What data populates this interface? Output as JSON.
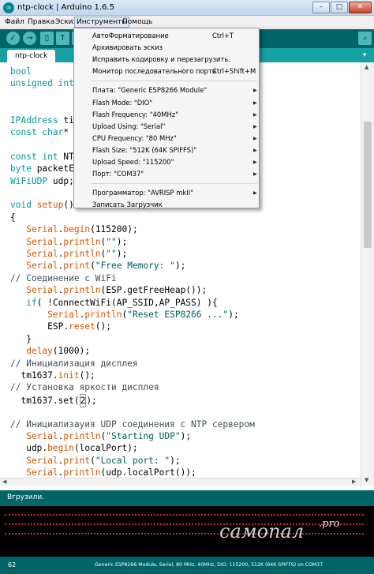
{
  "window": {
    "title": "ntp-clock | Arduino 1.6.5",
    "app_icon": "arduino-infinity-icon",
    "min_symbol": "–",
    "max_symbol": "□",
    "close_symbol": "✕"
  },
  "menubar": {
    "file": "Файл",
    "edit": "Правка",
    "sketch": "Эскиз",
    "tools": "Инструменты",
    "help": "Помощь"
  },
  "toolbar": {
    "verify_icon": "✓",
    "upload_icon": "→",
    "new_icon": "▯",
    "open_icon": "↑",
    "save_icon": "↓",
    "serial_icon": "⌕"
  },
  "tabs": {
    "active": "ntp-clock",
    "menu_icon": "▾"
  },
  "code": [
    [
      {
        "t": "kw",
        "v": "bool"
      }
    ],
    [
      {
        "t": "kw",
        "v": "unsigned int"
      }
    ],
    [],
    [],
    [
      {
        "t": "kw",
        "v": "IPAddress"
      },
      {
        "t": "tx",
        "v": " ti"
      }
    ],
    [
      {
        "t": "kw",
        "v": "const char"
      },
      {
        "t": "tx",
        "v": "*"
      }
    ],
    [],
    [
      {
        "t": "kw",
        "v": "const int"
      },
      {
        "t": "tx",
        "v": " NT"
      }
    ],
    [
      {
        "t": "kw",
        "v": "byte"
      },
      {
        "t": "tx",
        "v": " packetE"
      }
    ],
    [
      {
        "t": "kw",
        "v": "WiFiUDP"
      },
      {
        "t": "tx",
        "v": " udp;"
      }
    ],
    [],
    [
      {
        "t": "kw",
        "v": "void"
      },
      {
        "t": "tx",
        "v": " "
      },
      {
        "t": "fn",
        "v": "setup"
      },
      {
        "t": "tx",
        "v": "()"
      }
    ],
    [
      {
        "t": "tx",
        "v": "{"
      }
    ],
    [
      {
        "t": "tx",
        "v": "   "
      },
      {
        "t": "fn",
        "v": "Serial"
      },
      {
        "t": "tx",
        "v": "."
      },
      {
        "t": "fn",
        "v": "begin"
      },
      {
        "t": "tx",
        "v": "(115200);"
      }
    ],
    [
      {
        "t": "tx",
        "v": "   "
      },
      {
        "t": "fn",
        "v": "Serial"
      },
      {
        "t": "tx",
        "v": "."
      },
      {
        "t": "fn",
        "v": "println"
      },
      {
        "t": "tx",
        "v": "("
      },
      {
        "t": "str",
        "v": "\"\""
      },
      {
        "t": "tx",
        "v": ");"
      }
    ],
    [
      {
        "t": "tx",
        "v": "   "
      },
      {
        "t": "fn",
        "v": "Serial"
      },
      {
        "t": "tx",
        "v": "."
      },
      {
        "t": "fn",
        "v": "println"
      },
      {
        "t": "tx",
        "v": "("
      },
      {
        "t": "str",
        "v": "\"\""
      },
      {
        "t": "tx",
        "v": ");"
      }
    ],
    [
      {
        "t": "tx",
        "v": "   "
      },
      {
        "t": "fn",
        "v": "Serial"
      },
      {
        "t": "tx",
        "v": "."
      },
      {
        "t": "fn",
        "v": "print"
      },
      {
        "t": "tx",
        "v": "("
      },
      {
        "t": "str",
        "v": "\"Free Memory: \""
      },
      {
        "t": "tx",
        "v": ");"
      }
    ],
    [
      {
        "t": "cm",
        "v": "// Соединение с WiFi"
      }
    ],
    [
      {
        "t": "tx",
        "v": "   "
      },
      {
        "t": "fn",
        "v": "Serial"
      },
      {
        "t": "tx",
        "v": "."
      },
      {
        "t": "fn",
        "v": "println"
      },
      {
        "t": "tx",
        "v": "(ESP.getFreeHeap());"
      }
    ],
    [
      {
        "t": "tx",
        "v": "   "
      },
      {
        "t": "kw",
        "v": "if"
      },
      {
        "t": "tx",
        "v": "( !ConnectWiFi(AP_SSID,AP_PASS) ){"
      }
    ],
    [
      {
        "t": "tx",
        "v": "       "
      },
      {
        "t": "fn",
        "v": "Serial"
      },
      {
        "t": "tx",
        "v": "."
      },
      {
        "t": "fn",
        "v": "println"
      },
      {
        "t": "tx",
        "v": "("
      },
      {
        "t": "str",
        "v": "\"Reset ESP8266 ...\""
      },
      {
        "t": "tx",
        "v": ");"
      }
    ],
    [
      {
        "t": "tx",
        "v": "       ESP."
      },
      {
        "t": "fn",
        "v": "reset"
      },
      {
        "t": "tx",
        "v": "();"
      }
    ],
    [
      {
        "t": "tx",
        "v": "   }"
      }
    ],
    [
      {
        "t": "tx",
        "v": "   "
      },
      {
        "t": "fn",
        "v": "delay"
      },
      {
        "t": "tx",
        "v": "(1000);"
      }
    ],
    [
      {
        "t": "cm",
        "v": "// Инициализация дисплея"
      }
    ],
    [
      {
        "t": "tx",
        "v": "  tm1637."
      },
      {
        "t": "fn",
        "v": "init"
      },
      {
        "t": "tx",
        "v": "();"
      }
    ],
    [
      {
        "t": "cm",
        "v": "// Установка яркости дисплея"
      }
    ],
    [
      {
        "t": "tx",
        "v": "  tm1637.set("
      },
      {
        "t": "caret",
        "v": "2"
      },
      {
        "t": "tx",
        "v": ");"
      }
    ],
    [],
    [
      {
        "t": "cm",
        "v": "// Инициализауия UDP соединения с NTP сервером"
      }
    ],
    [
      {
        "t": "tx",
        "v": "   "
      },
      {
        "t": "fn",
        "v": "Serial"
      },
      {
        "t": "tx",
        "v": "."
      },
      {
        "t": "fn",
        "v": "println"
      },
      {
        "t": "tx",
        "v": "("
      },
      {
        "t": "str",
        "v": "\"Starting UDP\""
      },
      {
        "t": "tx",
        "v": ");"
      }
    ],
    [
      {
        "t": "tx",
        "v": "   udp."
      },
      {
        "t": "fn",
        "v": "begin"
      },
      {
        "t": "tx",
        "v": "(localPort);"
      }
    ],
    [
      {
        "t": "tx",
        "v": "   "
      },
      {
        "t": "fn",
        "v": "Serial"
      },
      {
        "t": "tx",
        "v": "."
      },
      {
        "t": "fn",
        "v": "print"
      },
      {
        "t": "tx",
        "v": "("
      },
      {
        "t": "str",
        "v": "\"Local port: \""
      },
      {
        "t": "tx",
        "v": ");"
      }
    ],
    [
      {
        "t": "tx",
        "v": "   "
      },
      {
        "t": "fn",
        "v": "Serial"
      },
      {
        "t": "tx",
        "v": "."
      },
      {
        "t": "fn",
        "v": "println"
      },
      {
        "t": "tx",
        "v": "(udp.localPort());"
      }
    ],
    [],
    [
      {
        "t": "tx",
        "v": "}"
      }
    ]
  ],
  "tools_menu": {
    "items": [
      {
        "label": "АвтоФорматирование",
        "shortcut": "Ctrl+T"
      },
      {
        "label": "Архивировать эскиз",
        "shortcut": ""
      },
      {
        "label": "Исправить кодировку и перезагрузить.",
        "shortcut": ""
      },
      {
        "label": "Монитор последовательного порта",
        "shortcut": "Ctrl+Shift+M"
      },
      {
        "sep": true
      },
      {
        "label": "Плата: \"Generic ESP8266 Module\"",
        "submenu": true
      },
      {
        "label": "Flash Mode: \"DIO\"",
        "submenu": true
      },
      {
        "label": "Flash Frequency: \"40MHz\"",
        "submenu": true
      },
      {
        "label": "Upload Using: \"Serial\"",
        "submenu": true
      },
      {
        "label": "CPU Frequency: \"80 MHz\"",
        "submenu": true
      },
      {
        "label": "Flash Size: \"512K (64K SPIFFS)\"",
        "submenu": true
      },
      {
        "label": "Upload Speed: \"115200\"",
        "submenu": true
      },
      {
        "label": "Порт: \"COM37\"",
        "submenu": true
      },
      {
        "sep": true
      },
      {
        "label": "Программатор: \"AVRISP mkII\"",
        "submenu": true
      },
      {
        "label": "Записать Загрузчик",
        "shortcut": ""
      }
    ],
    "submenu_arrow": "▶"
  },
  "console": {
    "status": "Вгрузили.",
    "watermark": "самопал",
    "watermark_sup": ".pro"
  },
  "statusbar": {
    "line": "62",
    "board_info": "Generic ESP8266 Module, Serial, 80 MHz, 40MHz, DIO, 115200, 512K (64K SPIFFS) on COM37"
  },
  "colors": {
    "toolbar": "#006468",
    "tabrow": "#17a1a5",
    "keyword": "#00979c",
    "function": "#d35400",
    "console_error": "#cc2a1f"
  }
}
